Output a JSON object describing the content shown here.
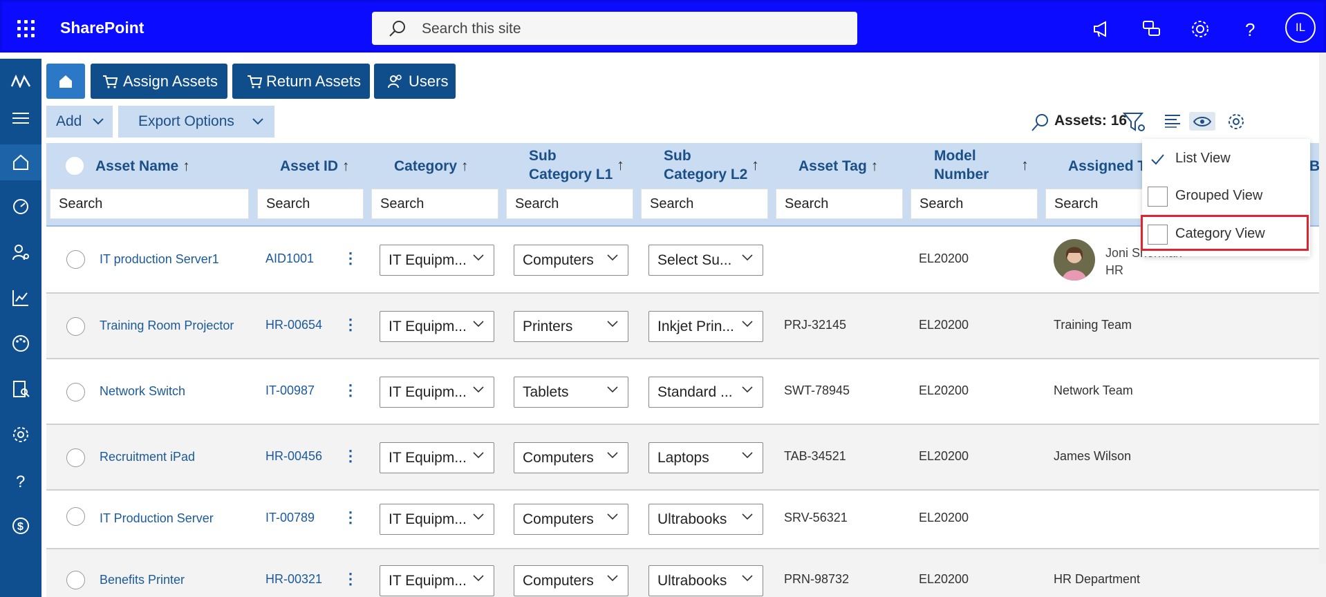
{
  "app": {
    "brand": "SharePoint",
    "search_placeholder": "Search this site",
    "user_initials": "IL"
  },
  "nav": {
    "assign_label": "Assign Assets",
    "return_label": "Return Assets",
    "users_label": "Users"
  },
  "toolbar": {
    "add_label": "Add",
    "export_label": "Export Options",
    "assets_count_label": "Assets: 16"
  },
  "columns": {
    "asset_name": "Asset Name",
    "asset_id": "Asset ID",
    "category": "Category",
    "sub_l1_line1": "Sub",
    "sub_l1_line2": "Category L1",
    "sub_l2_line1": "Sub",
    "sub_l2_line2": "Category L2",
    "asset_tag": "Asset Tag",
    "model_line1": "Model",
    "model_line2": "Number",
    "assigned_to": "Assigned To",
    "partial_last": "B",
    "sort_symbol": "↑"
  },
  "filter_placeholder": "Search",
  "rows": [
    {
      "name": "IT production Server1",
      "id": "AID1001",
      "category": "IT Equipm...",
      "sub1": "Computers",
      "sub2": "Select Su...",
      "tag": "",
      "model": "EL20200",
      "assigned_name": "Joni Sherman",
      "assigned_dept": "HR"
    },
    {
      "name": "Training Room Projector",
      "id": "HR-00654",
      "category": "IT Equipm...",
      "sub1": "Printers",
      "sub2": "Inkjet Prin...",
      "tag": "PRJ-32145",
      "model": "EL20200",
      "assigned": "Training Team"
    },
    {
      "name": "Network Switch",
      "id": "IT-00987",
      "category": "IT Equipm...",
      "sub1": "Tablets",
      "sub2": "Standard ...",
      "tag": "SWT-78945",
      "model": "EL20200",
      "assigned": "Network Team"
    },
    {
      "name": "Recruitment iPad",
      "id": "HR-00456",
      "category": "IT Equipm...",
      "sub1": "Computers",
      "sub2": "Laptops",
      "tag": "TAB-34521",
      "model": "EL20200",
      "assigned": "James Wilson"
    },
    {
      "name": "IT Production Server",
      "id": "IT-00789",
      "category": "IT Equipm...",
      "sub1": "Computers",
      "sub2": "Ultrabooks",
      "tag": "SRV-56321",
      "model": "EL20200",
      "assigned": ""
    },
    {
      "name": "Benefits Printer",
      "id": "HR-00321",
      "category": "IT Equipm...",
      "sub1": "Computers",
      "sub2": "Ultrabooks",
      "tag": "PRN-98732",
      "model": "EL20200",
      "assigned": "HR Department"
    }
  ],
  "view_menu": [
    {
      "label": "List View",
      "checked": true
    },
    {
      "label": "Grouped View",
      "checked": false
    },
    {
      "label": "Category View",
      "checked": false
    }
  ],
  "colors": {
    "suitebar": "#0b0bff",
    "rail": "#0f4f8f",
    "nav_button": "#104e8b",
    "header_bg": "#c9dcf1",
    "highlight": "#e0242f"
  },
  "icons": [
    "waffle-icon",
    "search-icon",
    "megaphone-icon",
    "chat-icon",
    "gear-icon",
    "help-icon",
    "home-icon",
    "cart-icon",
    "users-icon",
    "filter-icon",
    "list-icon",
    "eye-icon",
    "chevron-down-icon",
    "kebab-icon"
  ]
}
